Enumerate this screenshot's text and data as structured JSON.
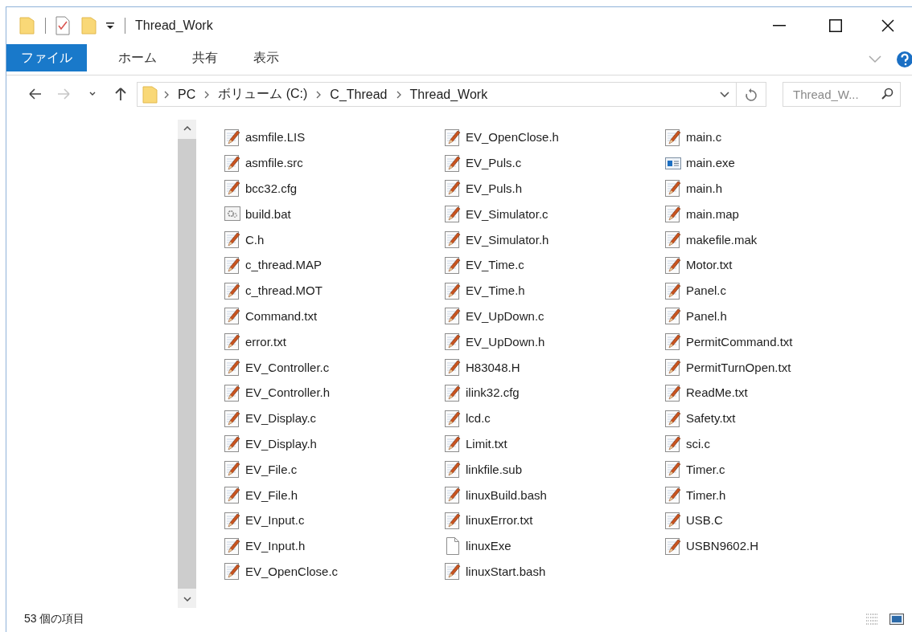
{
  "window": {
    "title": "Thread_Work"
  },
  "ribbon_tabs": [
    {
      "label": "ファイル",
      "selected": true
    },
    {
      "label": "ホーム",
      "selected": false
    },
    {
      "label": "共有",
      "selected": false
    },
    {
      "label": "表示",
      "selected": false
    }
  ],
  "nav_buttons": [
    {
      "kind": "back",
      "disabled": false
    },
    {
      "kind": "forward",
      "disabled": true
    },
    {
      "kind": "recent",
      "disabled": false
    },
    {
      "kind": "up",
      "disabled": false
    }
  ],
  "address": {
    "path": [
      "PC",
      "ボリューム (C:)",
      "C_Thread",
      "Thread_Work"
    ]
  },
  "search": {
    "placeholder": "Thread_W..."
  },
  "files": [
    {
      "name": "asmfile.LIS",
      "kind": "text"
    },
    {
      "name": "asmfile.src",
      "kind": "text"
    },
    {
      "name": "bcc32.cfg",
      "kind": "text"
    },
    {
      "name": "build.bat",
      "kind": "batch"
    },
    {
      "name": "C.h",
      "kind": "text"
    },
    {
      "name": "c_thread.MAP",
      "kind": "text"
    },
    {
      "name": "c_thread.MOT",
      "kind": "text"
    },
    {
      "name": "Command.txt",
      "kind": "text"
    },
    {
      "name": "error.txt",
      "kind": "text"
    },
    {
      "name": "EV_Controller.c",
      "kind": "text"
    },
    {
      "name": "EV_Controller.h",
      "kind": "text"
    },
    {
      "name": "EV_Display.c",
      "kind": "text"
    },
    {
      "name": "EV_Display.h",
      "kind": "text"
    },
    {
      "name": "EV_File.c",
      "kind": "text"
    },
    {
      "name": "EV_File.h",
      "kind": "text"
    },
    {
      "name": "EV_Input.c",
      "kind": "text"
    },
    {
      "name": "EV_Input.h",
      "kind": "text"
    },
    {
      "name": "EV_OpenClose.c",
      "kind": "text"
    },
    {
      "name": "EV_OpenClose.h",
      "kind": "text"
    },
    {
      "name": "EV_Puls.c",
      "kind": "text"
    },
    {
      "name": "EV_Puls.h",
      "kind": "text"
    },
    {
      "name": "EV_Simulator.c",
      "kind": "text"
    },
    {
      "name": "EV_Simulator.h",
      "kind": "text"
    },
    {
      "name": "EV_Time.c",
      "kind": "text"
    },
    {
      "name": "EV_Time.h",
      "kind": "text"
    },
    {
      "name": "EV_UpDown.c",
      "kind": "text"
    },
    {
      "name": "EV_UpDown.h",
      "kind": "text"
    },
    {
      "name": "H83048.H",
      "kind": "text"
    },
    {
      "name": "ilink32.cfg",
      "kind": "text"
    },
    {
      "name": "lcd.c",
      "kind": "text"
    },
    {
      "name": "Limit.txt",
      "kind": "text"
    },
    {
      "name": "linkfile.sub",
      "kind": "text"
    },
    {
      "name": "linuxBuild.bash",
      "kind": "text"
    },
    {
      "name": "linuxError.txt",
      "kind": "text"
    },
    {
      "name": "linuxExe",
      "kind": "blank"
    },
    {
      "name": "linuxStart.bash",
      "kind": "text"
    },
    {
      "name": "main.c",
      "kind": "text"
    },
    {
      "name": "main.exe",
      "kind": "exe"
    },
    {
      "name": "main.h",
      "kind": "text"
    },
    {
      "name": "main.map",
      "kind": "text"
    },
    {
      "name": "makefile.mak",
      "kind": "text"
    },
    {
      "name": "Motor.txt",
      "kind": "text"
    },
    {
      "name": "Panel.c",
      "kind": "text"
    },
    {
      "name": "Panel.h",
      "kind": "text"
    },
    {
      "name": "PermitCommand.txt",
      "kind": "text"
    },
    {
      "name": "PermitTurnOpen.txt",
      "kind": "text"
    },
    {
      "name": "ReadMe.txt",
      "kind": "text"
    },
    {
      "name": "Safety.txt",
      "kind": "text"
    },
    {
      "name": "sci.c",
      "kind": "text"
    },
    {
      "name": "Timer.c",
      "kind": "text"
    },
    {
      "name": "Timer.h",
      "kind": "text"
    },
    {
      "name": "USB.C",
      "kind": "text"
    },
    {
      "name": "USBN9602.H",
      "kind": "text"
    }
  ],
  "status_bar": {
    "item_count": "53 個の項目"
  }
}
